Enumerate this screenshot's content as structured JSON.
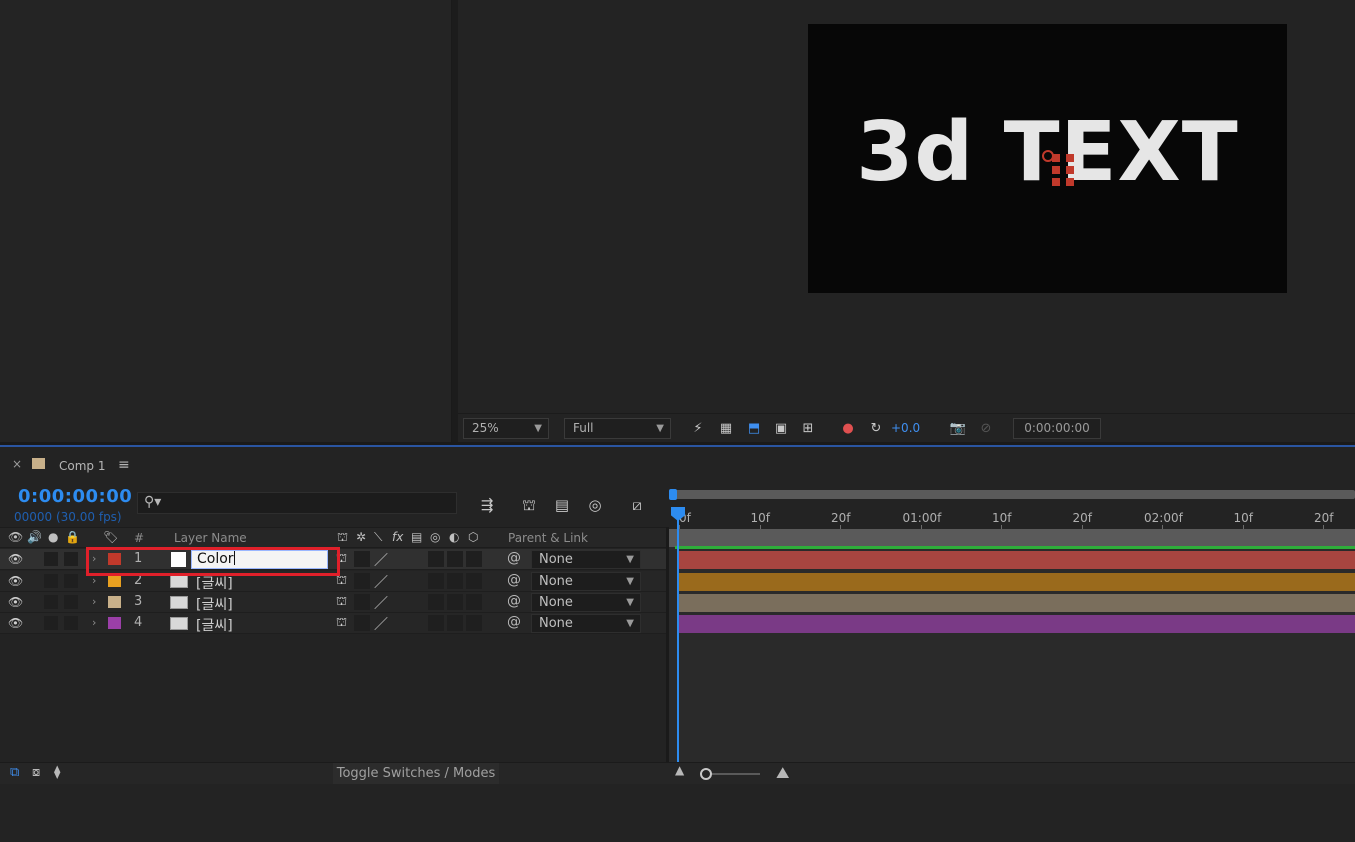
{
  "viewer": {
    "canvas_text": "3d TEXT",
    "zoom": "25%",
    "resolution": "Full",
    "exposure": "+0.0",
    "timecode": "0:00:00:00"
  },
  "timeline": {
    "tab_close": "×",
    "tab_name": "Comp 1",
    "tab_menu": "≡",
    "current_time": "0:00:00:00",
    "frame_info": "00000 (30.00 fps)",
    "search_placeholder": "",
    "columns": {
      "hash": "#",
      "layer_name": "Layer Name",
      "parent_link": "Parent & Link"
    },
    "layers": [
      {
        "num": "1",
        "name": "Color",
        "label_color": "#c0392b",
        "parent": "None",
        "bar_color": "#a84540",
        "editing": true
      },
      {
        "num": "2",
        "name": "[글씨]",
        "label_color": "#e8a020",
        "parent": "None",
        "bar_color": "#9a6a1c"
      },
      {
        "num": "3",
        "name": "[글씨]",
        "label_color": "#c8b08a",
        "parent": "None",
        "bar_color": "#7a6e5c"
      },
      {
        "num": "4",
        "name": "[글씨]",
        "label_color": "#9b3fa8",
        "parent": "None",
        "bar_color": "#7a3a86"
      }
    ],
    "ruler_ticks": [
      "0f",
      "10f",
      "20f",
      "01:00f",
      "10f",
      "20f",
      "02:00f",
      "10f",
      "20f"
    ],
    "toggle_label": "Toggle Switches / Modes"
  },
  "colors": {
    "accent": "#2d8cf0",
    "highlight": "#e0202a",
    "comp_swatch": "#c8b08a"
  }
}
